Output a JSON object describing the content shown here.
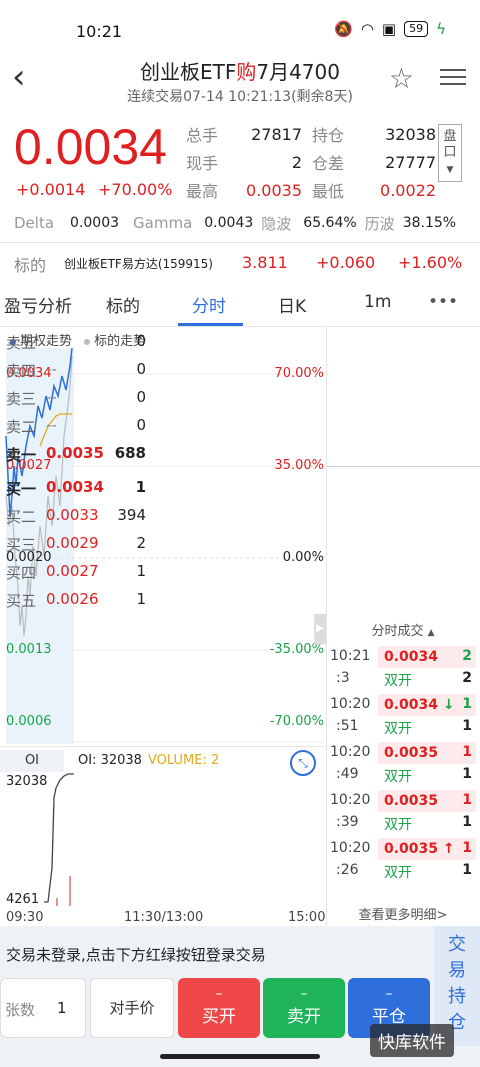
{
  "status": {
    "time": "10:21",
    "battery": "59"
  },
  "header": {
    "title_prefix": "创业板ETF",
    "title_buy": "购",
    "title_suffix": "7月4700",
    "subtitle": "连续交易07-14  10:21:13(剩余8天)"
  },
  "quote": {
    "price": "0.0034",
    "change": "+0.0014",
    "change_pct": "+70.00%",
    "rows": [
      {
        "l1": "总手",
        "v1": "27817",
        "l2": "持仓",
        "v2": "32038"
      },
      {
        "l1": "现手",
        "v1": "2",
        "l2": "仓差",
        "v2": "27777"
      },
      {
        "l1": "最高",
        "v1": "0.0035",
        "l2": "最低",
        "v2": "0.0022"
      }
    ],
    "pan_label": "盘口"
  },
  "greeks": {
    "delta_label": "Delta",
    "delta": "0.0003",
    "gamma_label": "Gamma",
    "gamma": "0.0043",
    "iv_label": "隐波",
    "iv": "65.64%",
    "hv_label": "历波",
    "hv": "38.15%"
  },
  "underlying": {
    "label": "标的",
    "name": "创业板ETF易方达(159915)",
    "price": "3.811",
    "change": "+0.060",
    "change_pct": "+1.60%"
  },
  "tabs": [
    "盈亏分析",
    "标的",
    "分时",
    "日K",
    "1m",
    "•••"
  ],
  "chart": {
    "legend_option": "期权走势",
    "legend_underlying": "标的走势",
    "left_labels": [
      "0.0034",
      "0.0027",
      "0.0020",
      "0.0013",
      "0.0006"
    ],
    "right_labels": [
      "70.00%",
      "35.00%",
      "0.00%",
      "-35.00%",
      "-70.00%"
    ],
    "oi_tab": "OI",
    "oi_text": "OI: 32038",
    "volume_text": "VOLUME: 2",
    "oi_top": "32038",
    "oi_bottom": "4261",
    "time_start": "09:30",
    "time_mid": "11:30/13:00",
    "time_end": "15:00"
  },
  "book": {
    "asks": [
      {
        "label": "卖五",
        "price": "--",
        "vol": "0"
      },
      {
        "label": "卖四",
        "price": "--",
        "vol": "0"
      },
      {
        "label": "卖三",
        "price": "--",
        "vol": "0"
      },
      {
        "label": "卖二",
        "price": "--",
        "vol": "0"
      },
      {
        "label": "卖一",
        "price": "0.0035",
        "vol": "688"
      }
    ],
    "bids": [
      {
        "label": "买一",
        "price": "0.0034",
        "vol": "1"
      },
      {
        "label": "买二",
        "price": "0.0033",
        "vol": "394"
      },
      {
        "label": "买三",
        "price": "0.0029",
        "vol": "2"
      },
      {
        "label": "买四",
        "price": "0.0027",
        "vol": "1"
      },
      {
        "label": "买五",
        "price": "0.0026",
        "vol": "1"
      }
    ],
    "ticks_title": "分时成交",
    "ticks": [
      {
        "time": "10:21",
        "sec": ":3",
        "price": "0.0034",
        "arrow": "",
        "vol": "2",
        "kind": "双开",
        "kvol": "2"
      },
      {
        "time": "10:20",
        "sec": ":51",
        "price": "0.0034",
        "arrow": "↓",
        "vol": "1",
        "kind": "双开",
        "kvol": "1"
      },
      {
        "time": "10:20",
        "sec": ":49",
        "price": "0.0035",
        "arrow": "",
        "vol": "1",
        "kind": "双开",
        "kvol": "1"
      },
      {
        "time": "10:20",
        "sec": ":39",
        "price": "0.0035",
        "arrow": "",
        "vol": "1",
        "kind": "双开",
        "kvol": "1"
      },
      {
        "time": "10:20",
        "sec": ":26",
        "price": "0.0035",
        "arrow": "↑",
        "vol": "1",
        "kind": "双开",
        "kvol": "1"
      }
    ],
    "more": "查看更多明细>"
  },
  "trade": {
    "notice": "交易未登录,点击下方红绿按钮登录交易",
    "side_button": "交易持仓",
    "qty_label": "张数",
    "qty_value": "1",
    "price_mode": "对手价",
    "buy_open_dash": "–",
    "buy_open": "买开",
    "sell_open_dash": "–",
    "sell_open": "卖开",
    "close_dash": "–",
    "close": "平仓"
  },
  "watermark": "快库软件",
  "colors": {
    "red": "#e02020",
    "green": "#1aa34a",
    "blue": "#2f6fdb",
    "orange": "#e6a817"
  }
}
